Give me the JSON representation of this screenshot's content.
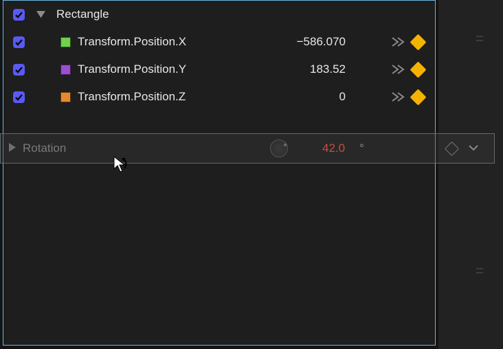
{
  "header": {
    "title": "Rectangle"
  },
  "properties": [
    {
      "label": "Transform.Position.X",
      "value": "−586.070",
      "color": "#6fd24a"
    },
    {
      "label": "Transform.Position.Y",
      "value": "183.52",
      "color": "#9a4fcf"
    },
    {
      "label": "Transform.Position.Z",
      "value": "0",
      "color": "#e68a2e"
    }
  ],
  "drag": {
    "label": "Rotation",
    "value": "42.0",
    "unit": "°"
  },
  "colors": {
    "checkbox": "#595af5",
    "keyframe": "#f5b301",
    "dragValue": "#c4513e"
  }
}
